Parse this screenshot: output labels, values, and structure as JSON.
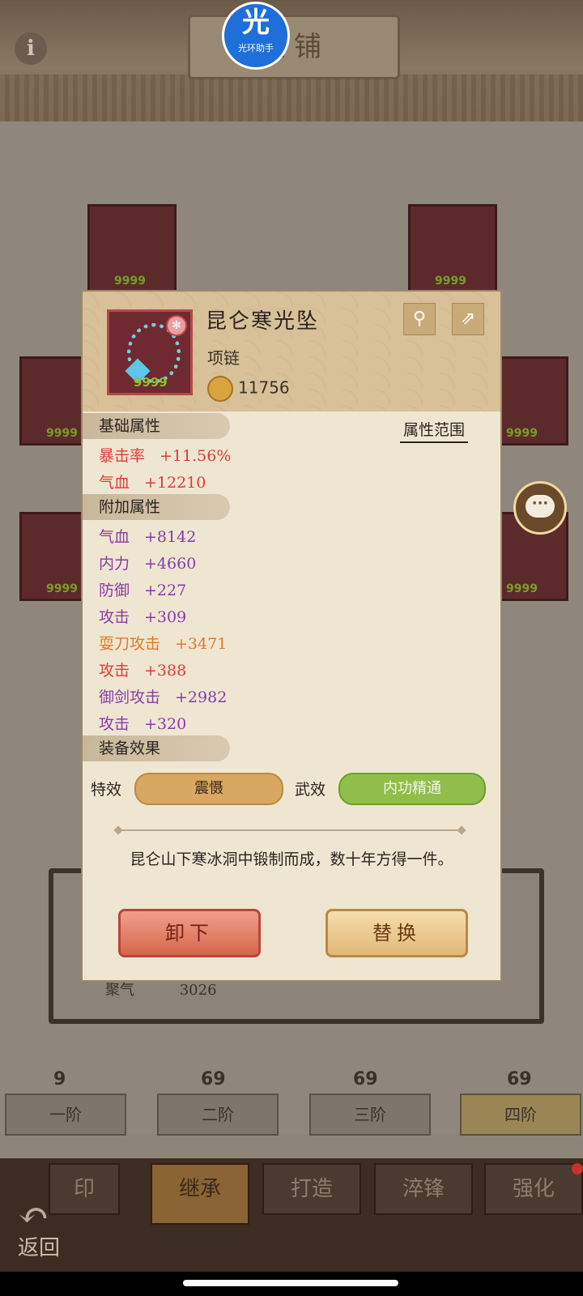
{
  "header": {
    "title": "匠铺",
    "info_icon": "i"
  },
  "assistant_logo": {
    "glyph": "光",
    "caption": "光环助手"
  },
  "popup": {
    "item_name": "昆仑寒光坠",
    "item_type": "项链",
    "item_count": "9999",
    "power": "11756",
    "sections": {
      "base": "基础属性",
      "extra": "附加属性",
      "effects": "装备效果",
      "attr_range": "属性范围"
    },
    "base_stats": [
      {
        "name": "暴击率",
        "value": "+11.56%"
      },
      {
        "name": "气血",
        "value": "+12210"
      }
    ],
    "extra_stats": [
      {
        "name": "气血",
        "value": "+8142"
      },
      {
        "name": "内力",
        "value": "+4660"
      },
      {
        "name": "防御",
        "value": "+227"
      },
      {
        "name": "攻击",
        "value": "+309"
      },
      {
        "name": "耍刀攻击",
        "value": "+3471"
      },
      {
        "name": "攻击",
        "value": "+388"
      },
      {
        "name": "御剑攻击",
        "value": "+2982"
      },
      {
        "name": "攻击",
        "value": "+320"
      }
    ],
    "effects": {
      "special_label": "特效",
      "special_value": "震慑",
      "martial_label": "武效",
      "martial_value": "内功精通"
    },
    "description": "昆仑山下寒冰洞中锻制而成，数十年方得一件。",
    "buttons": {
      "unequip": "卸下",
      "replace": "替换"
    }
  },
  "slots": {
    "count": "9999"
  },
  "underlay": {
    "label": "聚气",
    "value": "3026"
  },
  "tiers": [
    {
      "label": "一阶",
      "badge": "9"
    },
    {
      "label": "二阶",
      "badge": "69"
    },
    {
      "label": "三阶",
      "badge": "69"
    },
    {
      "label": "四阶",
      "badge": "69"
    }
  ],
  "bottom_nav": {
    "tabs": [
      "印",
      "继承",
      "打造",
      "淬锋",
      "强化"
    ],
    "back_label": "返回"
  }
}
